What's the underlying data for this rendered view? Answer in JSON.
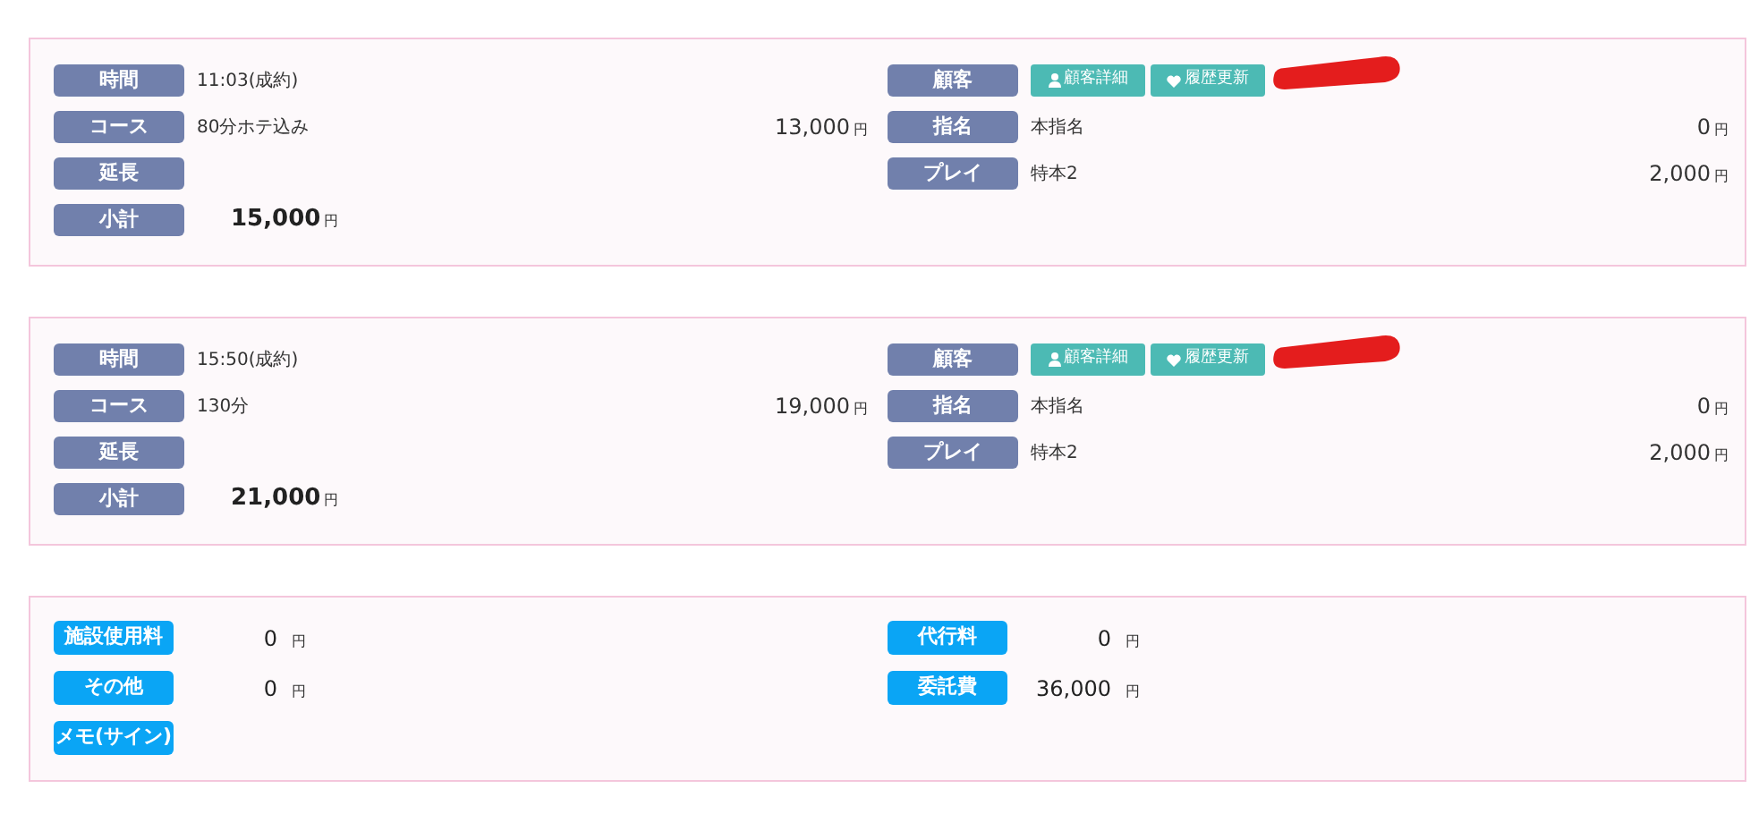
{
  "bookings": [
    {
      "left_rows": [
        {
          "kind": "text",
          "label": "時間",
          "value": "11:03(成約)"
        },
        {
          "kind": "text",
          "label": "コース",
          "value": "80分ホテ込み",
          "amount": "13,000",
          "unit": "円"
        },
        {
          "kind": "text",
          "label": "延長"
        },
        {
          "kind": "subtotal",
          "label": "小計",
          "amount": "15,000",
          "unit": "円"
        }
      ],
      "right_rows": [
        {
          "kind": "customer",
          "label": "顧客",
          "buttons": [
            "顧客詳細",
            "履歴更新"
          ],
          "redacted": true
        },
        {
          "kind": "text",
          "label": "指名",
          "value": "本指名",
          "amount": "0",
          "unit": "円"
        },
        {
          "kind": "text",
          "label": "プレイ",
          "value": "特本2",
          "amount": "2,000",
          "unit": "円"
        }
      ]
    },
    {
      "left_rows": [
        {
          "kind": "text",
          "label": "時間",
          "value": "15:50(成約)"
        },
        {
          "kind": "text",
          "label": "コース",
          "value": "130分",
          "amount": "19,000",
          "unit": "円"
        },
        {
          "kind": "text",
          "label": "延長"
        },
        {
          "kind": "subtotal",
          "label": "小計",
          "amount": "21,000",
          "unit": "円"
        }
      ],
      "right_rows": [
        {
          "kind": "customer",
          "label": "顧客",
          "buttons": [
            "顧客詳細",
            "履歴更新"
          ],
          "redacted": true
        },
        {
          "kind": "text",
          "label": "指名",
          "value": "本指名",
          "amount": "0",
          "unit": "円"
        },
        {
          "kind": "text",
          "label": "プレイ",
          "value": "特本2",
          "amount": "2,000",
          "unit": "円"
        }
      ]
    }
  ],
  "fees": {
    "left": [
      {
        "label": "施設使用料",
        "amount": "0",
        "unit": "円"
      },
      {
        "label": "その他",
        "amount": "0",
        "unit": "円"
      },
      {
        "label": "メモ(サイン)"
      }
    ],
    "right": [
      {
        "label": "代行料",
        "amount": "0",
        "unit": "円"
      },
      {
        "label": "委託費",
        "amount": "36,000",
        "unit": "円"
      }
    ]
  }
}
